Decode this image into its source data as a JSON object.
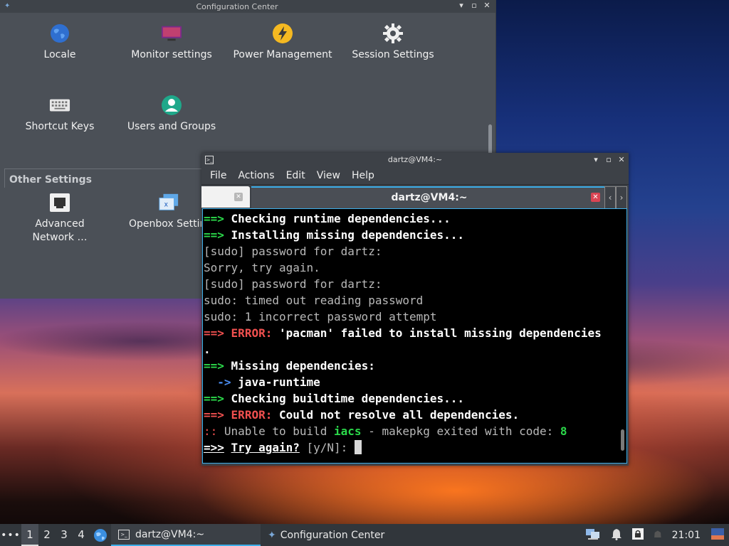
{
  "config_center": {
    "title": "Configuration Center",
    "items": [
      {
        "label": "Locale",
        "icon": "globe-icon"
      },
      {
        "label": "Monitor settings",
        "icon": "monitor-icon"
      },
      {
        "label": "Power Management",
        "icon": "lightning-icon"
      },
      {
        "label": "Session Settings",
        "icon": "gear-icon"
      },
      {
        "label": "Shortcut Keys",
        "icon": "keyboard-icon"
      },
      {
        "label": "Users and Groups",
        "icon": "user-icon"
      }
    ],
    "other_settings_header": "Other Settings",
    "other_items": [
      {
        "label": "Advanced Network …",
        "icon": "network-icon"
      },
      {
        "label": "Openbox Settin",
        "icon": "openbox-icon"
      }
    ]
  },
  "terminal": {
    "title": "dartz@VM4:~",
    "menu": [
      "File",
      "Actions",
      "Edit",
      "View",
      "Help"
    ],
    "tab_title": "dartz@VM4:~",
    "lines": {
      "l1": "Checking runtime dependencies...",
      "l2": "Installing missing dependencies...",
      "l3": "[sudo] password for dartz:",
      "l4": "Sorry, try again.",
      "l5": "[sudo] password for dartz:",
      "l6": "sudo: timed out reading password",
      "l7": "sudo: 1 incorrect password attempt",
      "l8": "'pacman' failed to install missing dependencies",
      "l9": ".",
      "l10": "Missing dependencies:",
      "l11": "java-runtime",
      "l12": "Checking buildtime dependencies...",
      "l13": "Could not resolve all dependencies.",
      "l14a": "Unable to build ",
      "l14b": "iacs",
      "l14c": " - makepkg exited with code: ",
      "l14d": "8",
      "l15a": "Try again?",
      "l15b": " [y/N]: "
    },
    "prefix_arrow": "==>",
    "prefix_error": "ERROR:",
    "prefix_sub": "  ->",
    "prefix_colons": "::",
    "prefix_prompt": "=>>"
  },
  "taskbar": {
    "dots": "•••",
    "workspaces": [
      "1",
      "2",
      "3",
      "4"
    ],
    "tasks": [
      "dartz@VM4:~",
      "Configuration Center"
    ],
    "clock": "21:01"
  },
  "colors": {
    "accent": "#3daee9",
    "green": "#2bd84a",
    "red": "#f0504f"
  }
}
